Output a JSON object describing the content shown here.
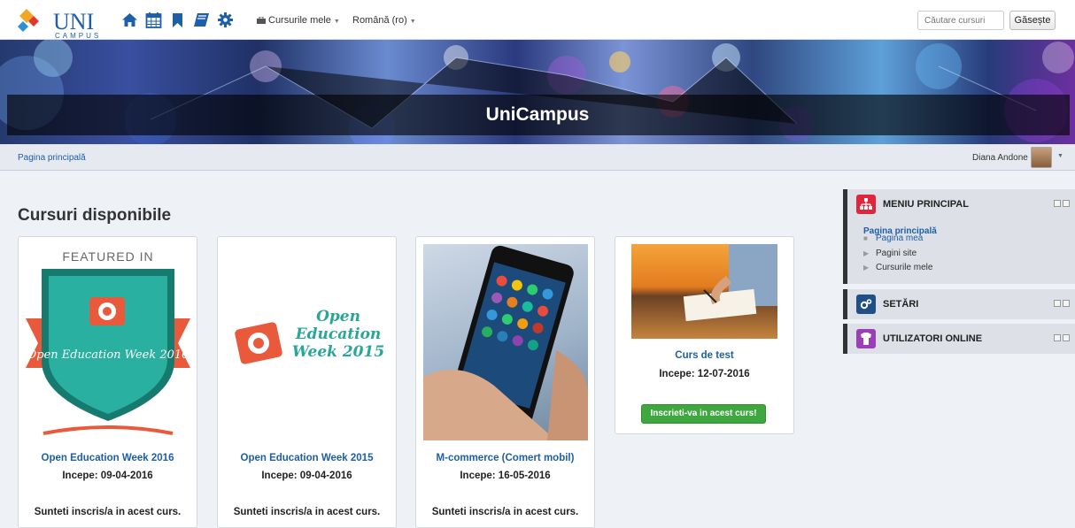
{
  "brand": {
    "logo_text": "UNI",
    "logo_sub": "CAMPUS"
  },
  "nav": {
    "icons": [
      "home-icon",
      "calendar-icon",
      "bookmark-icon",
      "book-icon",
      "gear-icon"
    ],
    "my_courses": "Cursurile mele",
    "language": "Română (ro)",
    "search_placeholder": "Căutare cursuri",
    "search_button": "Găsește"
  },
  "banner": {
    "title": "UniCampus"
  },
  "breadcrumb": {
    "home": "Pagina principală"
  },
  "user": {
    "name": "Diana Andone"
  },
  "main": {
    "title": "Cursuri disponibile",
    "courses": [
      {
        "image_label": "FEATURED IN",
        "image_text": "Open Education Week 2016",
        "title": "Open Education Week 2016",
        "start": "Incepe: 09-04-2016",
        "status": "Sunteti inscris/a in acest curs."
      },
      {
        "image_text": "Open Education Week 2015",
        "title": "Open Education Week 2015",
        "start": "Incepe: 09-04-2016",
        "status": "Sunteti inscris/a in acest curs."
      },
      {
        "title": "M-commerce (Comert mobil)",
        "start": "Incepe: 16-05-2016",
        "status": "Sunteti inscris/a in acest curs."
      },
      {
        "title": "Curs de test",
        "start": "Incepe: 12-07-2016",
        "enroll": "Inscrieti-va in acest curs!"
      }
    ]
  },
  "sidebar": {
    "menu": {
      "title": "MENIU PRINCIPAL",
      "home": "Pagina principală",
      "items": [
        "Pagina mea",
        "Pagini site",
        "Cursurile mele"
      ]
    },
    "settings": {
      "title": "SETĂRI"
    },
    "online": {
      "title": "UTILIZATORI ONLINE"
    }
  },
  "colors": {
    "accent": "#1d5fa8",
    "enroll": "#3fa73f",
    "menu_icon": "#e0263c",
    "settings_icon": "#1f4f86",
    "online_icon": "#9a3fb5"
  }
}
